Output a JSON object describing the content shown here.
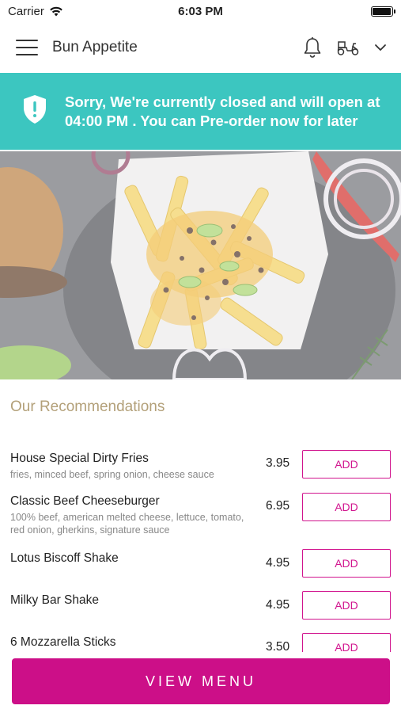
{
  "status_bar": {
    "carrier": "Carrier",
    "time": "6:03 PM",
    "battery_level": 0.95
  },
  "header": {
    "title": "Bun Appetite",
    "icons": [
      "menu-icon",
      "bell-icon",
      "scooter-icon",
      "chevron-down-icon"
    ]
  },
  "banner": {
    "message": "Sorry, We're currently closed and will open at 04:00 PM . You can Pre-order now for later",
    "background": "#3cc6c0",
    "icon": "shield-alert-icon"
  },
  "recommendations": {
    "title": "Our Recommendations",
    "items": [
      {
        "name": "House Special Dirty Fries",
        "description": "fries, minced beef, spring onion, cheese sauce",
        "price": "3.95",
        "add_label": "ADD"
      },
      {
        "name": "Classic Beef Cheeseburger",
        "description": "100% beef, american melted cheese, lettuce, tomato, red onion, gherkins, signature sauce",
        "price": "6.95",
        "add_label": "ADD"
      },
      {
        "name": "Lotus Biscoff Shake",
        "description": "",
        "price": "4.95",
        "add_label": "ADD"
      },
      {
        "name": "Milky Bar Shake",
        "description": "",
        "price": "4.95",
        "add_label": "ADD"
      },
      {
        "name": "6 Mozzarella Sticks",
        "description": "",
        "price": "3.50",
        "add_label": "ADD"
      }
    ]
  },
  "cta": {
    "view_menu_label": "VIEW MENU"
  },
  "colors": {
    "accent": "#cc0f88",
    "banner": "#3cc6c0",
    "section_title": "#b3a079"
  }
}
